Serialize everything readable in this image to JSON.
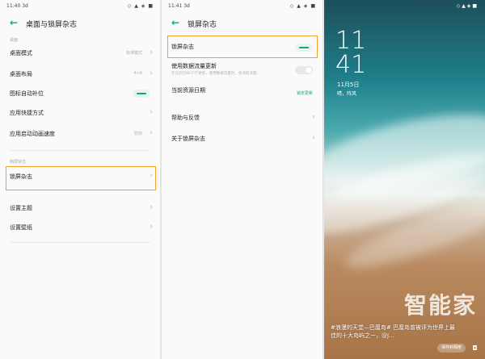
{
  "colors": {
    "accent": "#17a673",
    "highlight": "#f2a22b"
  },
  "screen1": {
    "status_time": "11:40 3d",
    "status_icons": "◇ ▲ ◈ ■",
    "title": "桌面与锁屏杂志",
    "section_desktop": "桌面",
    "rows": [
      {
        "label": "桌面模式",
        "value": "标准模式"
      },
      {
        "label": "桌面布局",
        "value": "4×6"
      },
      {
        "label": "图标自动补位"
      },
      {
        "label": "应用快捷方式"
      },
      {
        "label": "应用启动动画速度",
        "value": "较快"
      }
    ],
    "section_lockscreen": "锁屏杂志",
    "lock_row": "锁屏杂志",
    "theme_row": "设置主题",
    "wallpaper_row": "设置壁纸"
  },
  "screen2": {
    "status_time": "11:41 3d",
    "status_icons": "◇ ▲ ◈ ■",
    "title": "锁屏杂志",
    "lock_toggle_label": "锁屏杂志",
    "mobile_update_label": "使用数据流量更新",
    "mobile_update_sub": "在已开启Wi-Fi下更新，使用数据流量时，会消耗流量。",
    "source_label": "当前资源日期",
    "source_value": "锁定更新",
    "help_label": "帮助与反馈",
    "about_label": "关于锁屏杂志"
  },
  "lockscreen": {
    "status_icons": "◇ ▲ ◈ ■",
    "clock_hour": "11",
    "clock_min": "41",
    "date": "11月5日",
    "weather": "晴，阵风",
    "caption": "#浪漫的天堂—巴厘岛# 巴厘岛曾被评为世界上最佳的十大岛屿之一，@J...",
    "button": "保存到相册",
    "camera_icon": "camera-icon",
    "watermark": "智能家"
  }
}
